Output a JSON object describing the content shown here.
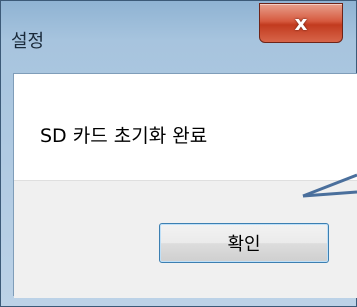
{
  "dialog": {
    "title": "설정",
    "close_glyph": "x",
    "message": "SD 카드 초기화 완료",
    "ok_label": "확인"
  },
  "colors": {
    "annotation_arrow": "#4a6f9c",
    "close_button": "#c94a2f",
    "button_focus_border": "#3c7fb1"
  }
}
